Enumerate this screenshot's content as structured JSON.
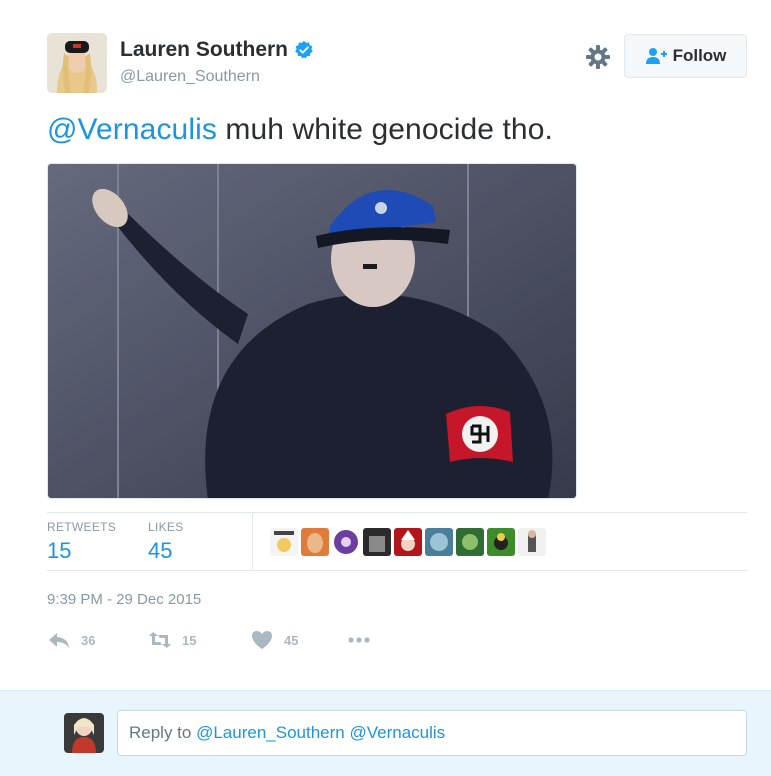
{
  "user": {
    "name": "Lauren Southern",
    "handle": "@Lauren_Southern",
    "avatar_icon": "user-avatar-photo",
    "verified_icon": "verified-badge-icon"
  },
  "header": {
    "follow_label": "Follow",
    "settings_icon": "gear-icon",
    "follow_icon": "add-user-icon"
  },
  "tweet": {
    "mention": "@Vernaculis",
    "text": " muh white genocide tho.",
    "media_description_icon": "tweet-photo"
  },
  "stats": {
    "retweets_label": "RETWEETS",
    "retweets_value": "15",
    "likes_label": "LIKES",
    "likes_value": "45"
  },
  "timestamp": "9:39 PM - 29 Dec 2015",
  "actions": {
    "reply_count": "36",
    "retweet_count": "15",
    "like_count": "45"
  },
  "reply": {
    "prefix": "Reply to ",
    "mentions": "@Lauren_Southern @Vernaculis"
  },
  "colors": {
    "accent": "#1b95e0",
    "muted": "#8899a6",
    "reply_bg": "#e8f5fd"
  }
}
